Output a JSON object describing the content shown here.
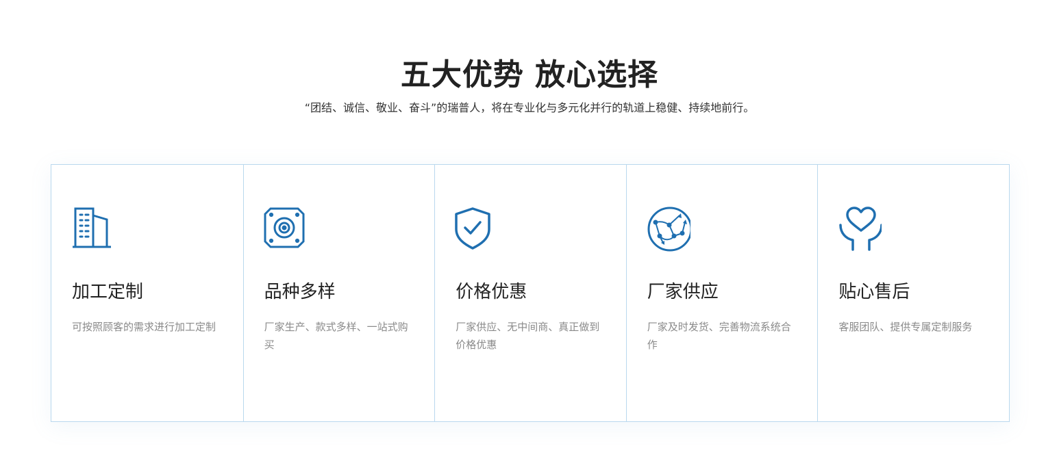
{
  "section": {
    "title": "五大优势 放心选择",
    "subtitle": "“团结、诚信、敬业、奋斗”的瑞普人，将在专业化与多元化并行的轨道上稳健、持续地前行。"
  },
  "colors": {
    "accent": "#1f6fb0",
    "border": "#b9d8ee",
    "title": "#222222",
    "desc": "#8a8a8a"
  },
  "features": [
    {
      "icon": "building-icon",
      "title": "加工定制",
      "desc": "可按照顾客的需求进行加工定制"
    },
    {
      "icon": "device-icon",
      "title": "品种多样",
      "desc": "厂家生产、款式多样、一站式购买"
    },
    {
      "icon": "shield-check-icon",
      "title": "价格优惠",
      "desc": "厂家供应、无中间商、真正做到价格优惠"
    },
    {
      "icon": "network-globe-icon",
      "title": "厂家供应",
      "desc": "厂家及时发货、完善物流系统合作"
    },
    {
      "icon": "heart-hands-icon",
      "title": "贴心售后",
      "desc": "客服团队、提供专属定制服务"
    }
  ]
}
